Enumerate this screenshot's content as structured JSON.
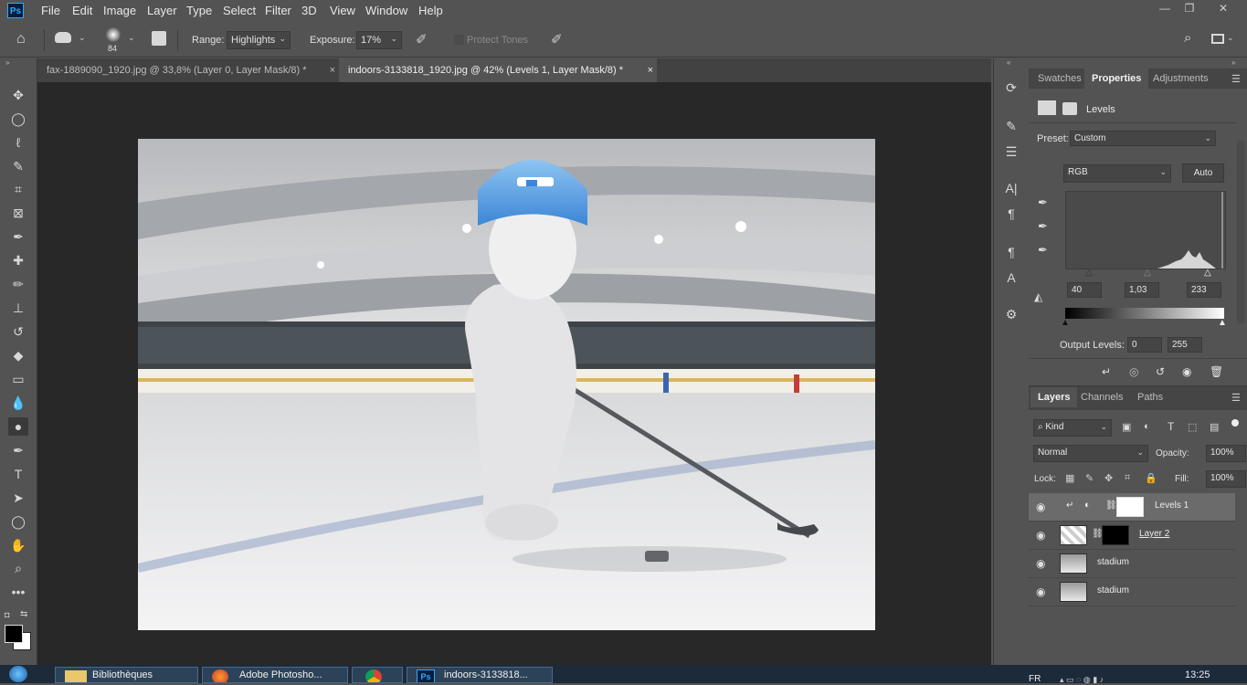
{
  "app": {
    "logo": "Ps",
    "window_controls": [
      "—",
      "❐",
      "✕"
    ]
  },
  "menu": [
    "File",
    "Edit",
    "Image",
    "Layer",
    "Type",
    "Select",
    "Filter",
    "3D",
    "View",
    "Window",
    "Help"
  ],
  "options": {
    "brush_size": "84",
    "range_label": "Range:",
    "range_value": "Highlights",
    "exposure_label": "Exposure:",
    "exposure_value": "17%",
    "protect_tones": "Protect Tones"
  },
  "tabs": [
    {
      "label": "fax-1889090_1920.jpg @ 33,8% (Layer 0, Layer Mask/8) *",
      "close": "×"
    },
    {
      "label": "indoors-3133818_1920.jpg @ 42% (Levels 1, Layer Mask/8) *",
      "close": "×"
    }
  ],
  "panel_top": {
    "tabs": [
      "Swatches",
      "Properties",
      "Adjustments"
    ],
    "title": "Levels",
    "preset_label": "Preset:",
    "preset_value": "Custom",
    "channel": "RGB",
    "auto": "Auto",
    "input_levels": [
      "40",
      "1,03",
      "233"
    ],
    "output_label": "Output Levels:",
    "output_levels": [
      "0",
      "255"
    ]
  },
  "layers_panel": {
    "tabs": [
      "Layers",
      "Channels",
      "Paths"
    ],
    "kind": "Kind",
    "blend_mode": "Normal",
    "opacity_label": "Opacity:",
    "opacity": "100%",
    "lock_label": "Lock:",
    "fill_label": "Fill:",
    "fill": "100%",
    "layers": [
      {
        "name": "Levels 1",
        "selected": true
      },
      {
        "name": "Layer 2",
        "selected": false
      },
      {
        "name": "stadium",
        "selected": false
      },
      {
        "name": "stadium",
        "selected": false
      }
    ]
  },
  "taskbar": {
    "items": [
      "Bibliothèques",
      "Adobe Photosho...",
      "",
      "indoors-3133818..."
    ],
    "lang": "FR",
    "time": "13:25"
  }
}
